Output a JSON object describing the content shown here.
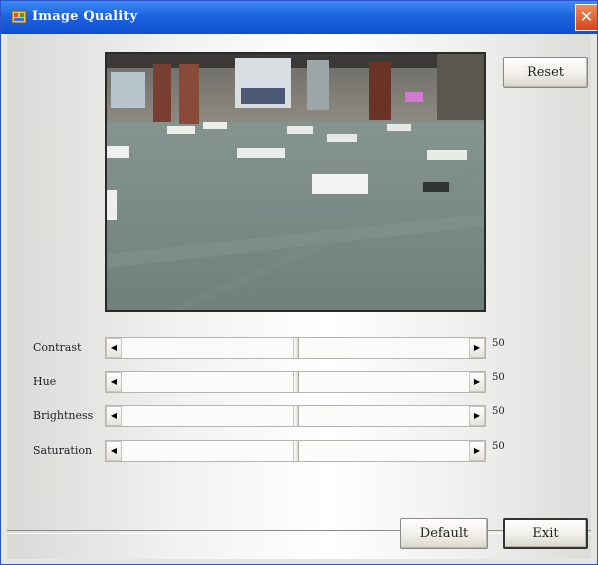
{
  "window": {
    "title": "Image Quality",
    "close_glyph": "✕",
    "titlebar_color": "#1d63e0"
  },
  "video": {
    "description_icon": "camera-feed"
  },
  "buttons": {
    "reset": "Reset",
    "default": "Default",
    "exit": "Exit"
  },
  "sliders": [
    {
      "label": "Contrast",
      "value": "50",
      "level": 0.5
    },
    {
      "label": "Hue",
      "value": "50",
      "level": 0.5
    },
    {
      "label": "Brightness",
      "value": "50",
      "level": 0.5
    },
    {
      "label": "Saturation",
      "value": "50",
      "level": 0.5
    }
  ],
  "arrows": {
    "left": "◀",
    "right": "▶"
  }
}
